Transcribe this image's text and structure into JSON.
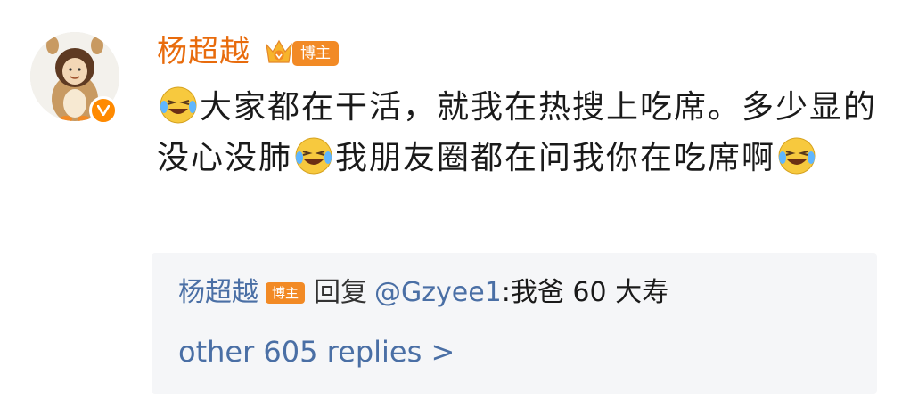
{
  "post": {
    "username": "杨超越",
    "badge": "博主",
    "text_1": "大家都在干活，就我在热搜上吃席。多少显的没心没肺",
    "text_2": "我朋友圈都在问我你在吃席啊",
    "emoji": "laughing-crying-emoji"
  },
  "reply": {
    "username": "杨超越",
    "badge": "博主",
    "prefix": "回复",
    "mention": "@Gzyee1",
    "text": ":我爸 60 大寿",
    "more_label": "other 605 replies >"
  },
  "colors": {
    "username": "#e86b0c",
    "badge": "#f28a25",
    "link": "#4a6fa5",
    "reply_bg": "#f5f6f8"
  }
}
